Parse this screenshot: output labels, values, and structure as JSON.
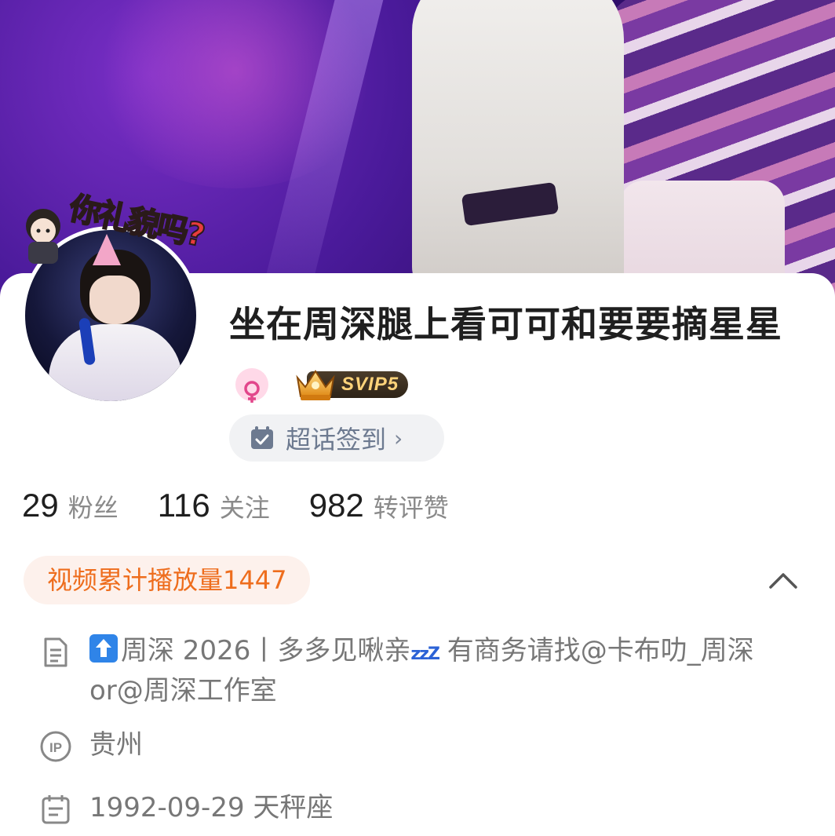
{
  "profile": {
    "name": "坐在周深腿上看可可和要要摘星星",
    "avatar_frame_text": "你礼貌吗?",
    "vip_label": "SVIP5",
    "checkin_label": "超话签到",
    "checkin_arrow": "›"
  },
  "stats": [
    {
      "num": "29",
      "label": "粉丝"
    },
    {
      "num": "116",
      "label": "关注"
    },
    {
      "num": "982",
      "label": "转评赞"
    }
  ],
  "play_tag": "视频累计播放量1447",
  "bio": {
    "prefix": "周深 2026丨多多见啾亲",
    "zzz": "zzZ",
    "suffix": " 有商务请找@卡布叻_周深or@周深工作室"
  },
  "location": "贵州",
  "birthday": "1992-09-29 天秤座",
  "icons": [
    "cover-photo",
    "avatar-image",
    "female-icon",
    "svip-crown-icon",
    "calendar-check-icon",
    "chevron-up-icon",
    "document-icon",
    "up-arrow-emoji-icon",
    "ip-icon",
    "calendar-icon"
  ],
  "colors": {
    "play_tag_text": "#ee6d1d",
    "play_tag_bg": "#fdf1ec",
    "checkin_text": "#6d7a90",
    "female_icon": "#e2468b",
    "vip_gold": "#ffd37a"
  }
}
